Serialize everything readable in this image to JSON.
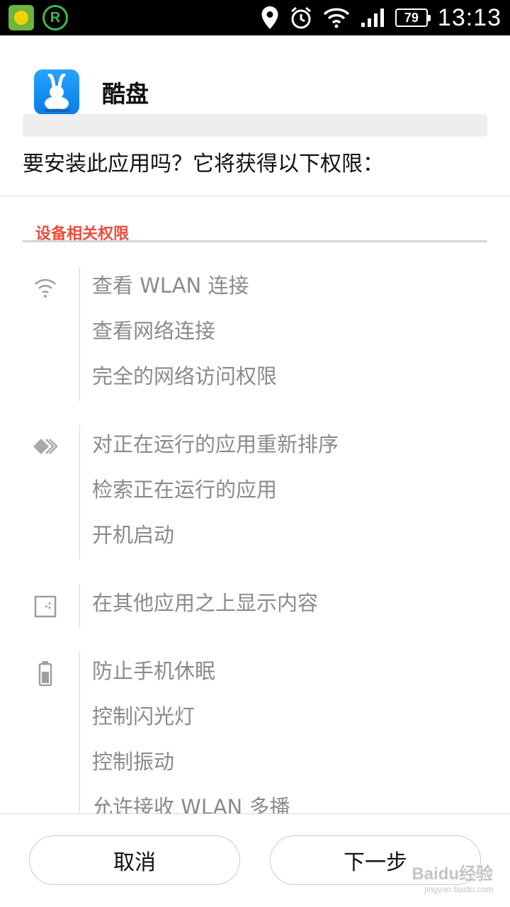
{
  "status_bar": {
    "time": "13:13",
    "battery_level": "79",
    "left_icons": [
      "notification-app-icon",
      "notification-r-icon"
    ],
    "right_icons": [
      "location-icon",
      "alarm-icon",
      "wifi-icon",
      "signal-icon"
    ]
  },
  "app": {
    "name": "酷盘",
    "install_question": "要安装此应用吗？它将获得以下权限："
  },
  "section": {
    "title": "设备相关权限",
    "title_color": "#f04b3d"
  },
  "permission_groups": [
    {
      "icon": "wifi-icon",
      "items": [
        "查看 WLAN 连接",
        "查看网络连接",
        "完全的网络访问权限"
      ]
    },
    {
      "icon": "apps-stack-icon",
      "items": [
        "对正在运行的应用重新排序",
        "检索正在运行的应用",
        "开机启动"
      ]
    },
    {
      "icon": "overlay-window-icon",
      "items": [
        "在其他应用之上显示内容"
      ]
    },
    {
      "icon": "battery-icon",
      "items": [
        "防止手机休眠",
        "控制闪光灯",
        "控制振动",
        "允许接收 WLAN 多播"
      ]
    }
  ],
  "buttons": {
    "cancel": "取消",
    "next": "下一步"
  },
  "watermark": {
    "brand": "Baidu经验",
    "url": "jingyan.baidu.com"
  }
}
